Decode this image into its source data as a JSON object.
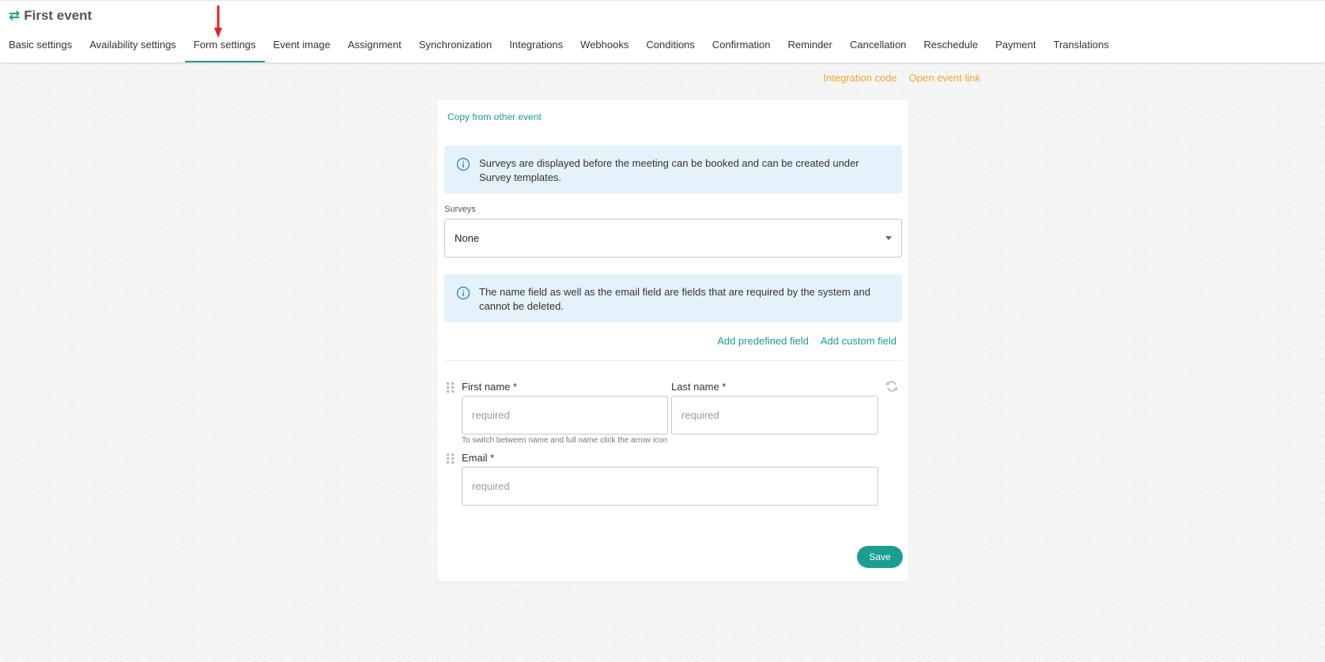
{
  "header": {
    "title": "First event",
    "icon": "swap-arrows-icon",
    "tabs": [
      {
        "label": "Basic settings"
      },
      {
        "label": "Availability settings"
      },
      {
        "label": "Form settings",
        "active": true
      },
      {
        "label": "Event image"
      },
      {
        "label": "Assignment"
      },
      {
        "label": "Synchronization"
      },
      {
        "label": "Integrations"
      },
      {
        "label": "Webhooks"
      },
      {
        "label": "Conditions"
      },
      {
        "label": "Confirmation"
      },
      {
        "label": "Reminder"
      },
      {
        "label": "Cancellation"
      },
      {
        "label": "Reschedule"
      },
      {
        "label": "Payment"
      },
      {
        "label": "Translations"
      }
    ]
  },
  "top_links": {
    "integration_code": "Integration code",
    "open_event_link": "Open event link"
  },
  "card": {
    "copy_link": "Copy from other event",
    "surveys_info": "Surveys are displayed before the meeting can be booked and can be created under Survey templates.",
    "surveys_label": "Surveys",
    "surveys_value": "None",
    "fields_info": "The name field as well as the email field are fields that are required by the system and cannot be deleted.",
    "add_predefined": "Add predefined field",
    "add_custom": "Add custom field",
    "fields": {
      "first_name_label": "First name *",
      "first_name_placeholder": "required",
      "last_name_label": "Last name *",
      "last_name_placeholder": "required",
      "name_hint": "To switch between name and full name click the arrow icon",
      "email_label": "Email *",
      "email_placeholder": "required"
    },
    "save_label": "Save"
  },
  "colors": {
    "accent": "#1a9e8f",
    "link_orange": "#f0a830",
    "info_bg": "#e6f2fb",
    "annotation_arrow": "#e8201c"
  }
}
